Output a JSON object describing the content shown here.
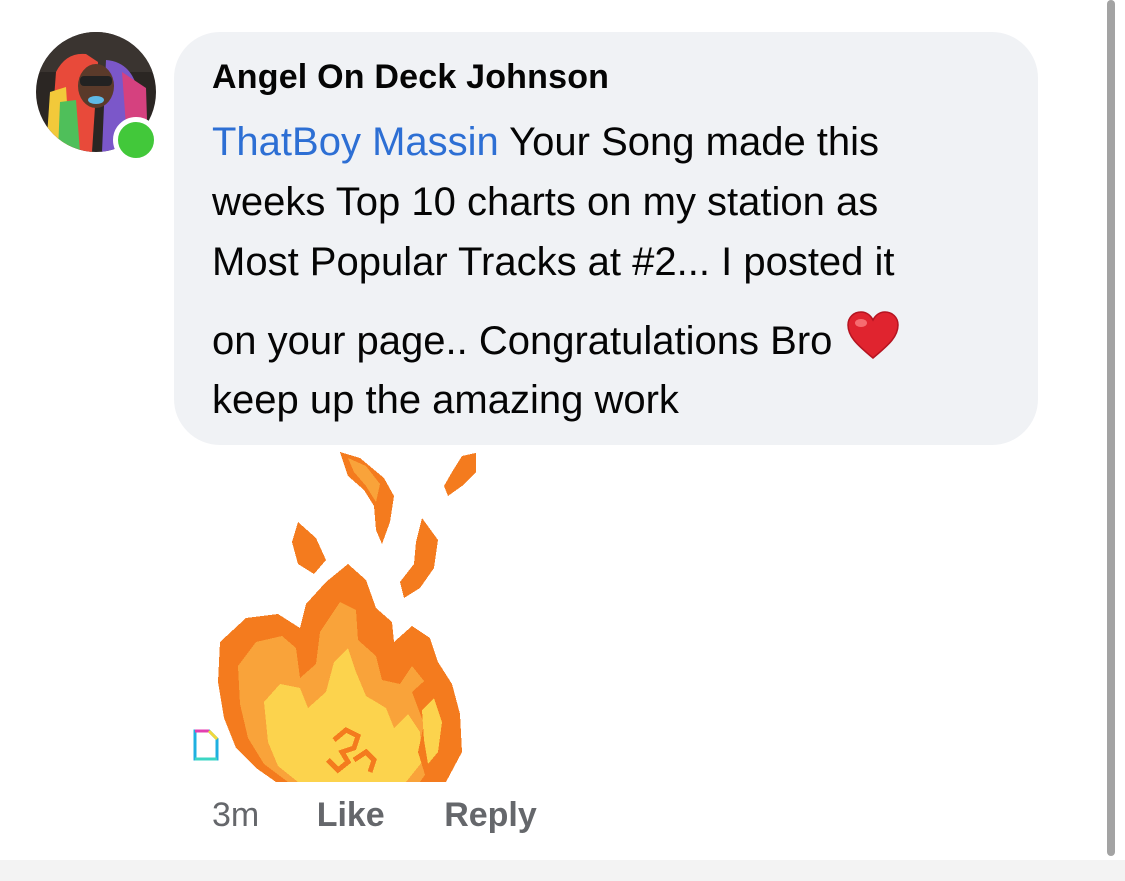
{
  "comment": {
    "author": "Angel On Deck Johnson",
    "mention": "ThatBoy Massin",
    "lines": [
      " Your Song made this",
      "weeks Top 10 charts on my station as",
      "Most Popular Tracks at #2... I posted it",
      "on your page.. Congratulations Bro",
      "keep up the amazing work"
    ],
    "emoji": "red-heart-icon",
    "sticker": "pixel-fire-sticker",
    "online_status_color": "#42c83a",
    "mention_color": "#2d6fd4"
  },
  "actions": {
    "time": "3m",
    "like": "Like",
    "reply": "Reply"
  }
}
